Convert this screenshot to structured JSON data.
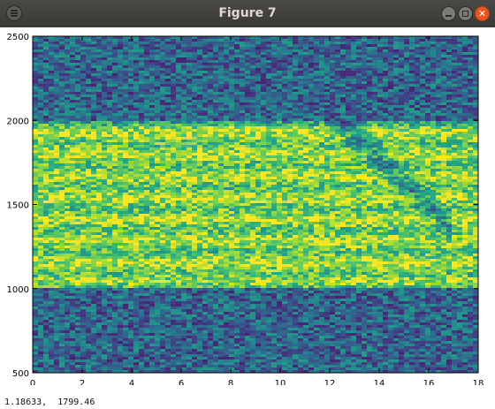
{
  "window": {
    "title": "Figure 7",
    "menu_icon": "hamburger-menu-icon",
    "minimize_icon": "minimize-icon",
    "maximize_icon": "maximize-icon",
    "close_icon": "close-icon",
    "close_glyph": "✕",
    "close_color": "#e95420"
  },
  "status_bar": {
    "coordinates": "1.18633,  1799.46"
  },
  "chart_data": {
    "type": "heatmap",
    "colormap": "viridis",
    "title": "",
    "xlabel": "",
    "ylabel": "",
    "xlim": [
      0,
      18
    ],
    "ylim": [
      500,
      2500
    ],
    "xticks": [
      "0",
      "2",
      "4",
      "6",
      "8",
      "10",
      "12",
      "14",
      "16",
      "18"
    ],
    "yticks": [
      "500",
      "1000",
      "1500",
      "2000",
      "2500"
    ],
    "grid": false,
    "description_of_intensity": {
      "high_band_y_range": [
        1000,
        2000
      ],
      "background_level": "low-medium noise",
      "dark_diagonal_trace_x_range": [
        12,
        17
      ]
    }
  }
}
